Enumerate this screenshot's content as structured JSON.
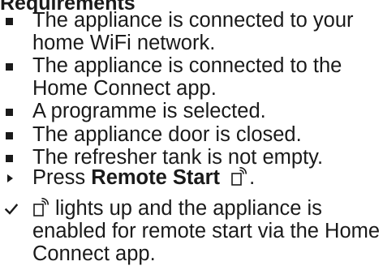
{
  "requirements": {
    "heading": "Requirements",
    "items": [
      "The appliance is connected to your home WiFi network.",
      "The appliance is connected to the Home Connect app.",
      "A programme is selected.",
      "The appliance door is closed.",
      "The refresher tank is not empty."
    ]
  },
  "step": {
    "prefix": "Press",
    "button_name": "Remote Start",
    "suffix": ".",
    "icon": "remote-start-icon"
  },
  "result": {
    "icon": "remote-start-icon",
    "text": "lights up and the appliance is enabled for remote start via the Home Connect app."
  }
}
